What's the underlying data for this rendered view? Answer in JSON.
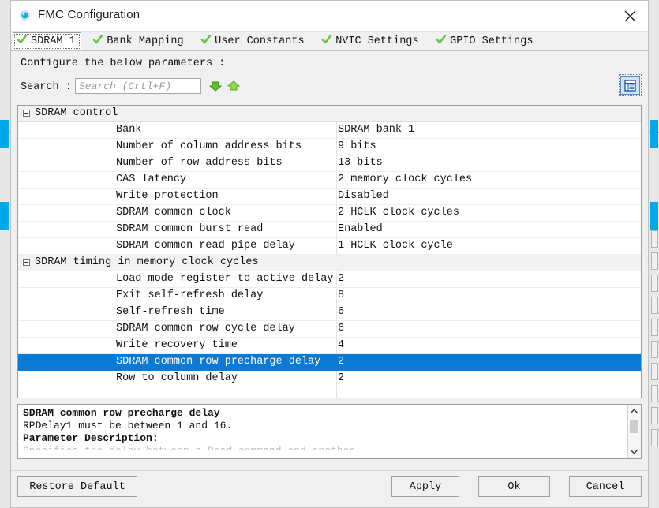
{
  "window": {
    "title": "FMC Configuration",
    "icon": "app-icon",
    "close_label": "✕"
  },
  "tabs": [
    {
      "label": "SDRAM 1",
      "icon": "check-icon",
      "active": true
    },
    {
      "label": "Bank Mapping",
      "icon": "check-icon",
      "active": false
    },
    {
      "label": "User Constants",
      "icon": "check-icon",
      "active": false
    },
    {
      "label": "NVIC Settings",
      "icon": "check-icon",
      "active": false
    },
    {
      "label": "GPIO Settings",
      "icon": "check-icon",
      "active": false
    }
  ],
  "instruction": "Configure the below parameters :",
  "search": {
    "label": "Search :",
    "value": "",
    "placeholder": "Search (Crtl+F)",
    "next_icon": "arrow-down-icon",
    "prev_icon": "arrow-up-icon",
    "grid_icon": "table-view-icon"
  },
  "tree": {
    "groups": [
      {
        "label": "SDRAM control",
        "expanded": true,
        "rows": [
          {
            "name": "Bank",
            "value": "SDRAM bank 1",
            "selected": false
          },
          {
            "name": "Number of column address bits",
            "value": "9 bits",
            "selected": false
          },
          {
            "name": "Number of row address bits",
            "value": "13 bits",
            "selected": false
          },
          {
            "name": "CAS latency",
            "value": "2 memory clock cycles",
            "selected": false
          },
          {
            "name": "Write protection",
            "value": "Disabled",
            "selected": false
          },
          {
            "name": "SDRAM common clock",
            "value": "2 HCLK clock cycles",
            "selected": false
          },
          {
            "name": "SDRAM common burst read",
            "value": "Enabled",
            "selected": false
          },
          {
            "name": "SDRAM common read pipe delay",
            "value": "1 HCLK clock cycle",
            "selected": false
          }
        ]
      },
      {
        "label": "SDRAM timing in memory clock cycles",
        "expanded": true,
        "rows": [
          {
            "name": "Load mode register to active delay",
            "value": "2",
            "selected": false
          },
          {
            "name": "Exit self-refresh delay",
            "value": "8",
            "selected": false
          },
          {
            "name": "Self-refresh time",
            "value": "6",
            "selected": false
          },
          {
            "name": "SDRAM common row cycle delay",
            "value": "6",
            "selected": false
          },
          {
            "name": "Write recovery time",
            "value": "4",
            "selected": false
          },
          {
            "name": "SDRAM common row precharge delay",
            "value": "2",
            "selected": true
          },
          {
            "name": "Row to column delay",
            "value": "2",
            "selected": false
          }
        ]
      }
    ]
  },
  "description": {
    "title": "SDRAM common row precharge delay",
    "constraint": "RPDelay1 must be between 1 and 16.",
    "section": "Parameter Description:",
    "clipped": "Specifies the delay between a Read command and another"
  },
  "footer": {
    "restore_label": "Restore Default",
    "apply_label": "Apply",
    "ok_label": "Ok",
    "cancel_label": "Cancel"
  },
  "colors": {
    "selection": "#0a7ad4",
    "accent": "#00a8e8",
    "check": "#6cc24a",
    "dialog_bg": "#f0f0f0"
  }
}
